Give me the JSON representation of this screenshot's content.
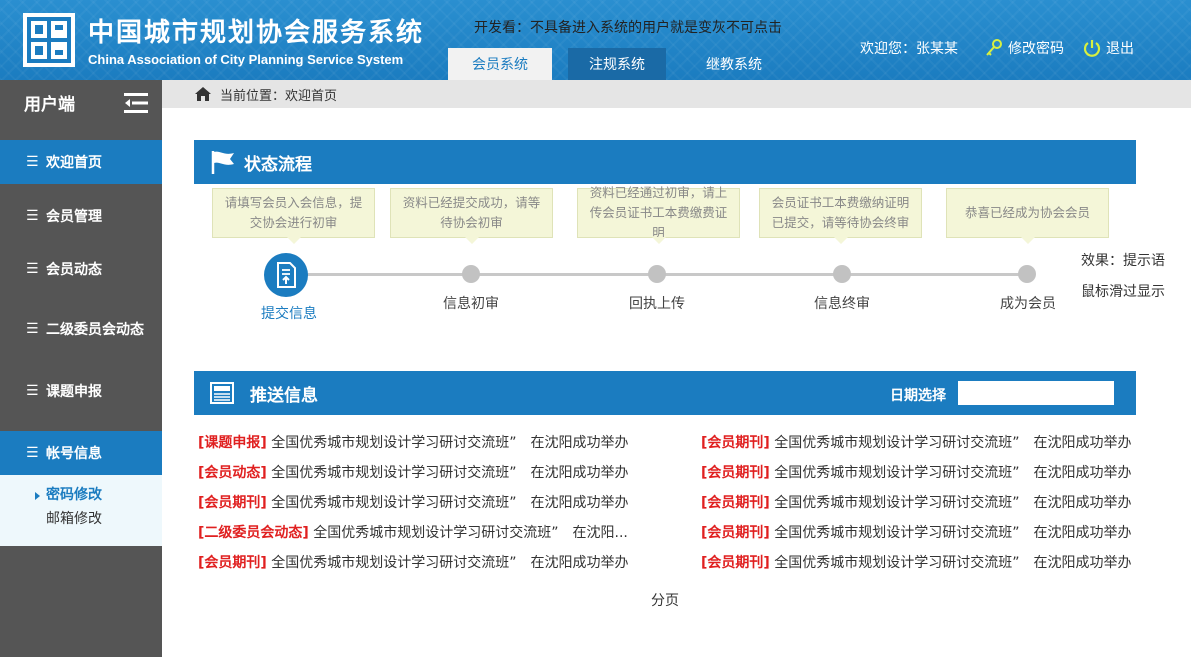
{
  "header": {
    "brand_cn": "中国城市规划协会服务系统",
    "brand_en": "China Association of City Planning Service System",
    "dev_note": "开发看：不具备进入系统的用户就是变灰不可点击",
    "tabs": [
      {
        "label": "会员系统",
        "state": "active"
      },
      {
        "label": "注规系统",
        "state": "dark"
      },
      {
        "label": "继教系统",
        "state": "plain"
      }
    ],
    "welcome": "欢迎您：张某某",
    "change_password": "修改密码",
    "logout": "退出"
  },
  "sidebar": {
    "title": "用户端",
    "items": [
      {
        "label": "欢迎首页",
        "active": true
      },
      {
        "label": "会员管理",
        "active": false
      },
      {
        "label": "会员动态",
        "active": false
      },
      {
        "label": "二级委员会动态",
        "active": false
      },
      {
        "label": "课题申报",
        "active": false
      },
      {
        "label": "帐号信息",
        "active": true
      }
    ],
    "subitems": [
      {
        "label": "密码修改",
        "active": true
      },
      {
        "label": "邮箱修改",
        "active": false
      }
    ]
  },
  "breadcrumb": "当前位置：欢迎首页",
  "status_panel": {
    "title": "状态流程",
    "tips": [
      "请填写会员入会信息，提交协会进行初审",
      "资料已经提交成功，请等待协会初审",
      "资料已经通过初审，请上传会员证书工本费缴费证明",
      "会员证书工本费缴纳证明已提交，请等待协会终审",
      "恭喜已经成为协会会员"
    ],
    "steps": [
      "提交信息",
      "信息初审",
      "回执上传",
      "信息终审",
      "成为会员"
    ],
    "note_line1": "效果：提示语",
    "note_line2": "鼠标滑过显示"
  },
  "push_panel": {
    "title": "推送信息",
    "date_label": "日期选择",
    "date_value": "",
    "left_news": [
      {
        "tag": "[课题申报]",
        "text": "全国优秀城市规划设计学习研讨交流班”　在沈阳成功举办"
      },
      {
        "tag": "[会员动态]",
        "text": "全国优秀城市规划设计学习研讨交流班”　在沈阳成功举办"
      },
      {
        "tag": "[会员期刊]",
        "text": "全国优秀城市规划设计学习研讨交流班”　在沈阳成功举办"
      },
      {
        "tag": "[二级委员会动态]",
        "text": "全国优秀城市规划设计学习研讨交流班”　在沈阳..."
      },
      {
        "tag": "[会员期刊]",
        "text": "全国优秀城市规划设计学习研讨交流班”　在沈阳成功举办"
      }
    ],
    "right_news": [
      {
        "tag": "[会员期刊]",
        "text": "全国优秀城市规划设计学习研讨交流班”　在沈阳成功举办"
      },
      {
        "tag": "[会员期刊]",
        "text": "全国优秀城市规划设计学习研讨交流班”　在沈阳成功举办"
      },
      {
        "tag": "[会员期刊]",
        "text": "全国优秀城市规划设计学习研讨交流班”　在沈阳成功举办"
      },
      {
        "tag": "[会员期刊]",
        "text": "全国优秀城市规划设计学习研讨交流班”　在沈阳成功举办"
      },
      {
        "tag": "[会员期刊]",
        "text": "全国优秀城市规划设计学习研讨交流班”　在沈阳成功举办"
      }
    ],
    "pager": "分页"
  },
  "colors": {
    "primary": "#1b7cc0",
    "sidebar": "#555555",
    "tag_red": "#e02020",
    "tip_bg": "#f4f6d8"
  }
}
